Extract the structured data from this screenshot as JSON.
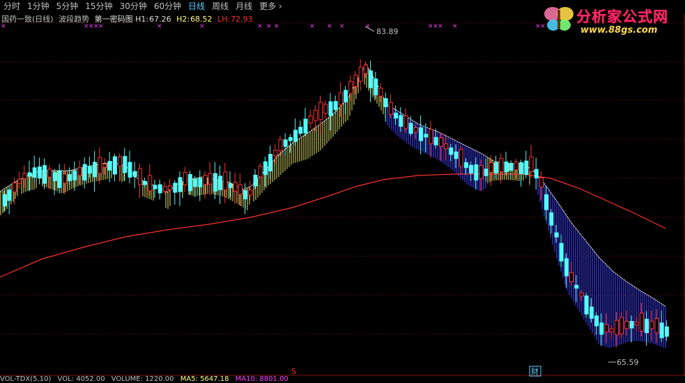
{
  "toolbar": {
    "timeframes": [
      "分时",
      "1分钟",
      "5分钟",
      "15分钟",
      "30分钟",
      "60分钟",
      "日线",
      "周线",
      "月线",
      "更多"
    ],
    "active": "日线"
  },
  "info": {
    "stock": "国药一致(日线)",
    "indicator": "波段趋势",
    "formula": "第一密码图",
    "h1_label": "H1:",
    "h1": "67.26",
    "h2_label": "H2:",
    "h2": "68.52",
    "lh_label": "LH:",
    "lh": "72.93"
  },
  "logo": {
    "brand": "分析家公式网",
    "url": "www.88gs.com"
  },
  "chart": {
    "high_label": "83.89",
    "low_label": "65.59",
    "marker_s": "S",
    "marker_cai": "财"
  },
  "volume_bar": {
    "text1": "VOL-TDX(5,10)",
    "text2": "VOL: 4052.00",
    "text3": "VOLUME: 1220.00",
    "text4": "MA5: 5647.18",
    "text5": "MA10: 8801.00"
  },
  "colors": {
    "up": "#ff3232",
    "down": "#54fcfc",
    "bull_fill": "#ffff80",
    "bear_fill": "#3333cc",
    "ma": "#ff3030",
    "grid": "#801010"
  }
}
